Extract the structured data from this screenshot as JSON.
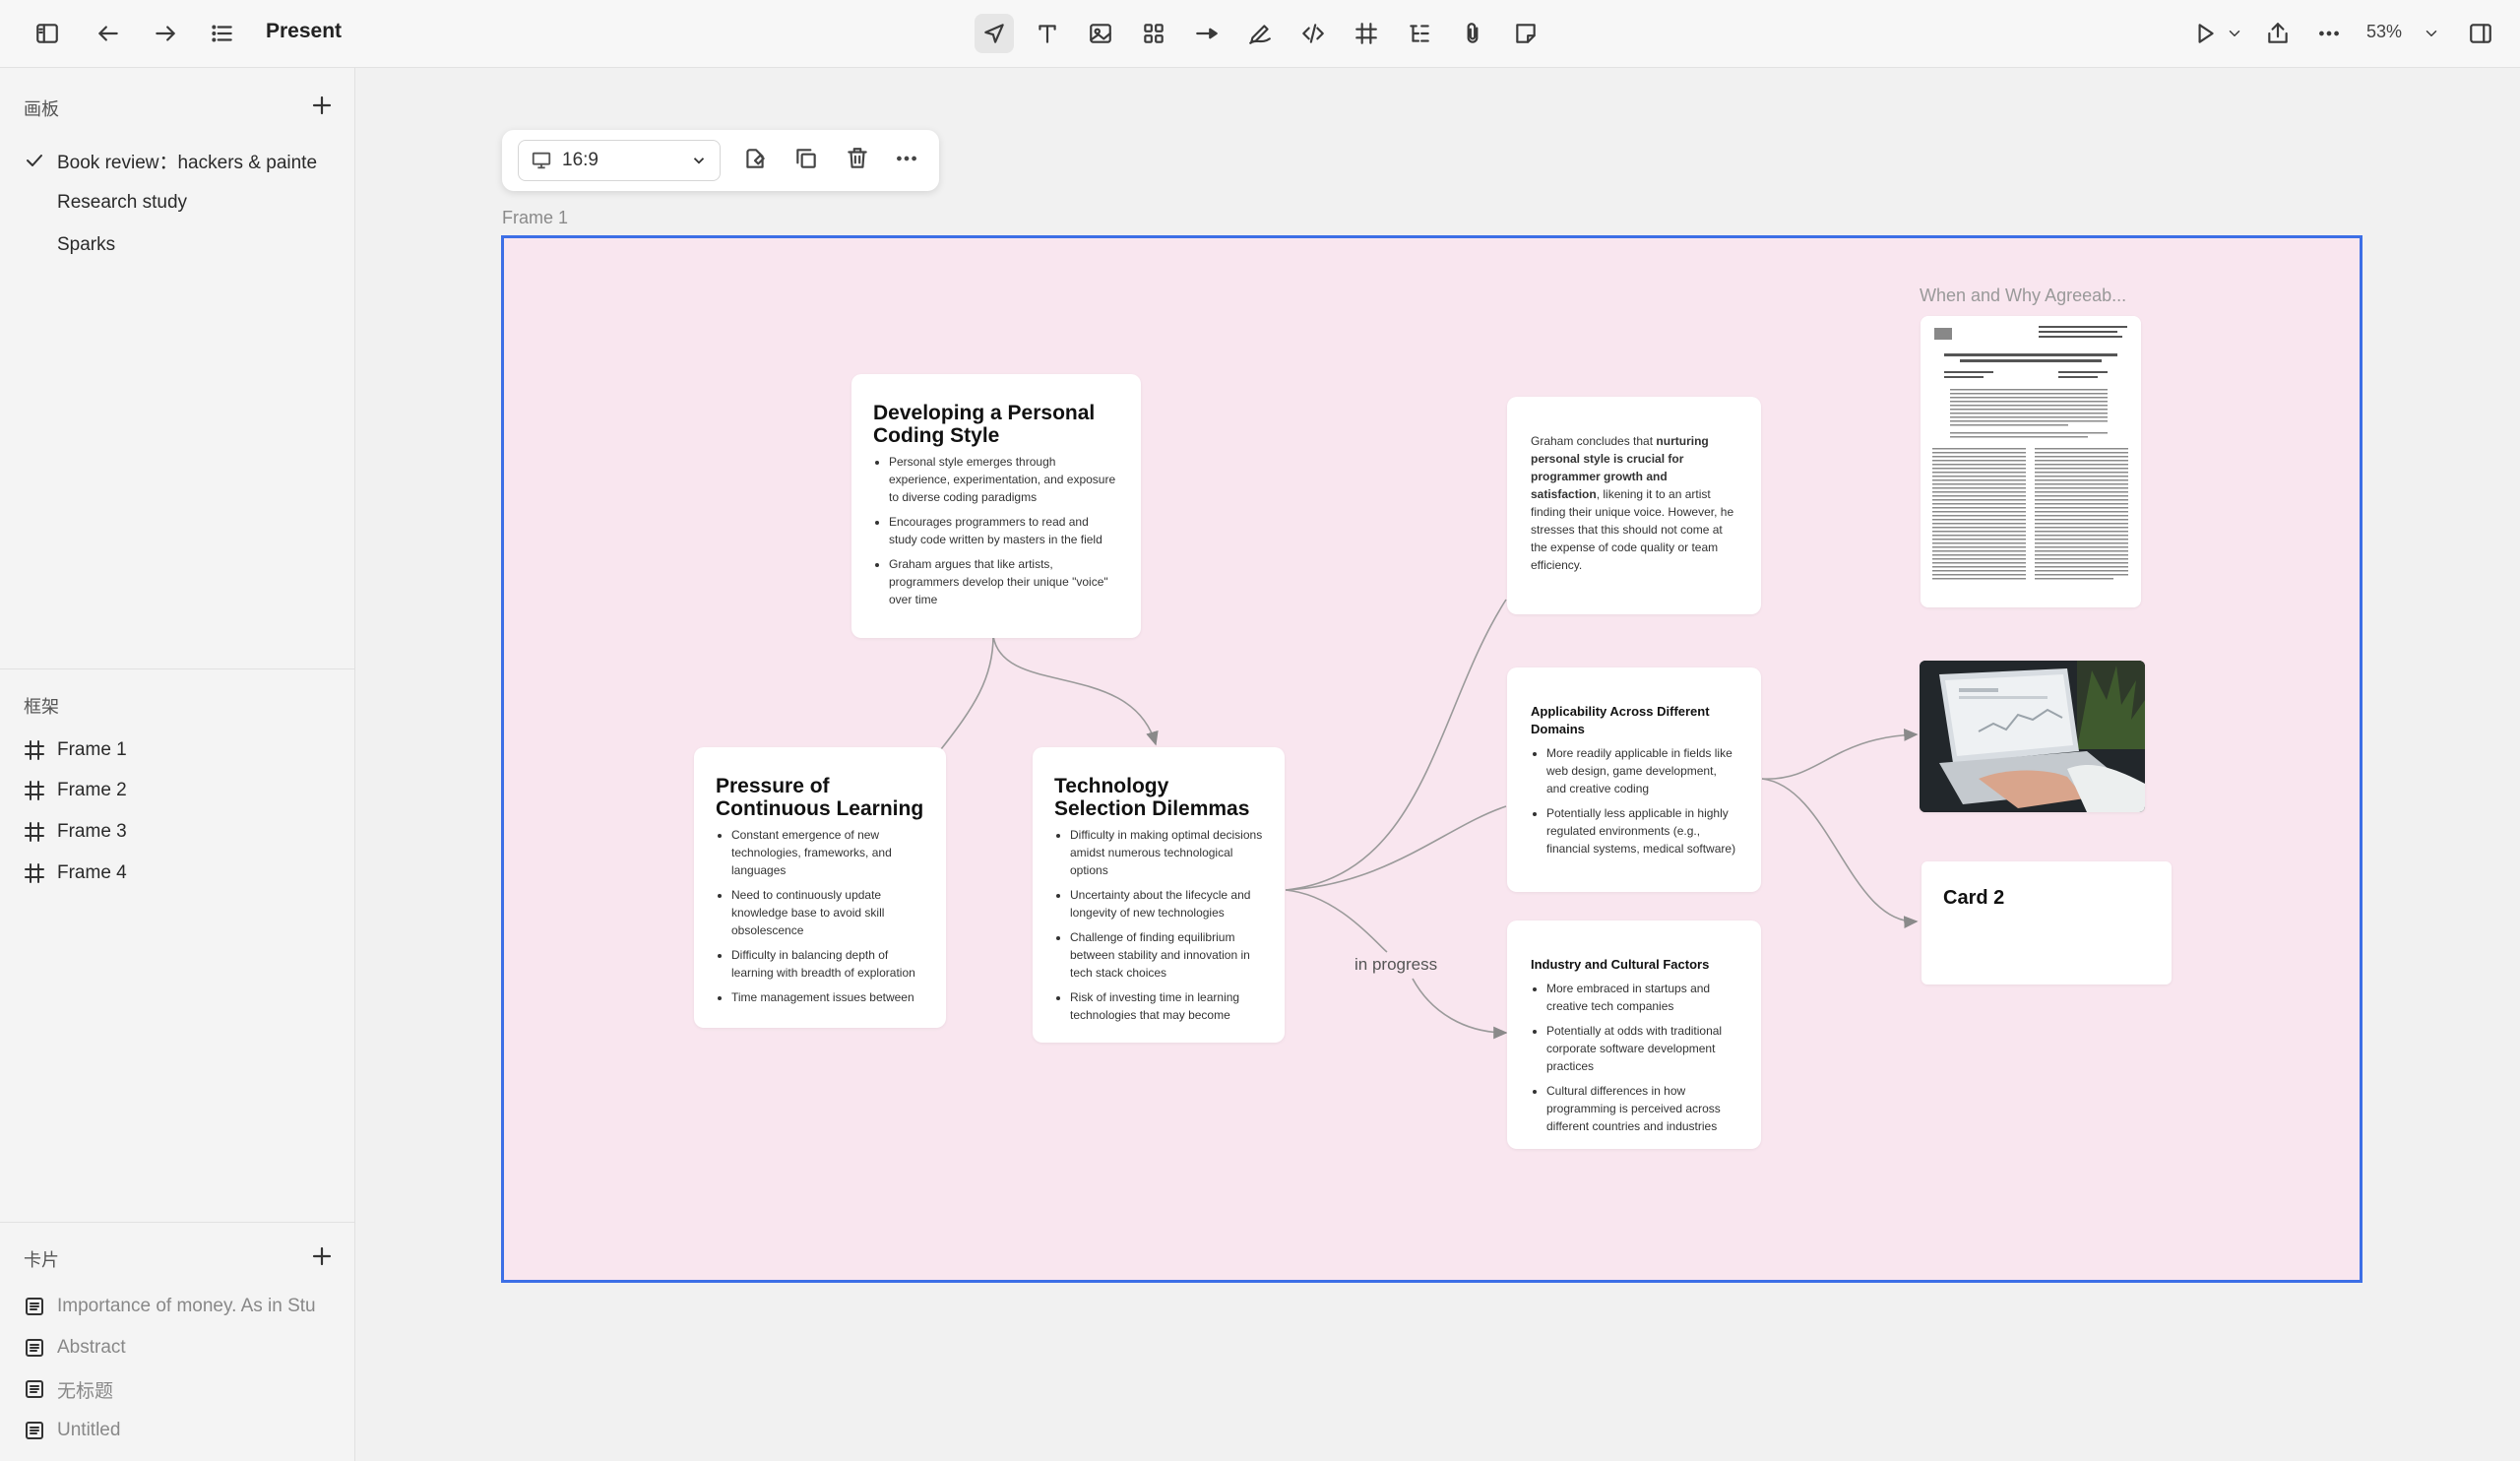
{
  "topbar": {
    "title": "Present",
    "zoom": "53%",
    "icons": [
      "sidebar-toggle-icon",
      "back-arrow-icon",
      "forward-arrow-icon",
      "outline-list-icon",
      "select-cursor-icon",
      "text-icon",
      "image-icon",
      "components-icon",
      "connector-arrow-icon",
      "pen-icon",
      "code-icon",
      "frame-icon",
      "mindmap-icon",
      "attachment-icon",
      "sticky-note-icon",
      "play-icon",
      "chevron-down-icon",
      "share-icon",
      "more-icon",
      "chevron-down-icon",
      "right-panel-icon"
    ]
  },
  "sidebar": {
    "boards_title": "画板",
    "boards": [
      {
        "label": "Book review：hackers & painte",
        "checked": true
      },
      {
        "label": "Research study",
        "checked": false
      },
      {
        "label": "Sparks",
        "checked": false
      }
    ],
    "frames_title": "框架",
    "frames": [
      "Frame 1",
      "Frame 2",
      "Frame 3",
      "Frame 4"
    ],
    "cards_title": "卡片",
    "cards": [
      "Importance of money. As in Stu",
      "Abstract",
      "无标题",
      "Untitled"
    ]
  },
  "frame_toolbar": {
    "ratio": "16:9"
  },
  "frame": {
    "label": "Frame 1",
    "background": "#f9e6ef",
    "border": "#3d6fe6"
  },
  "cards": {
    "coding_style": {
      "title": "Developing a Personal Coding Style",
      "bullets": [
        "Personal style emerges through experience, experimentation, and exposure to diverse coding paradigms",
        "Encourages programmers to read and study code written by masters in the field",
        "Graham argues that like artists, programmers develop their unique \"voice\" over time"
      ]
    },
    "pressure": {
      "title": "Pressure of Continuous Learning",
      "bullets": [
        "Constant emergence of new technologies, frameworks, and languages",
        "Need to continuously update knowledge base to avoid skill obsolescence",
        "Difficulty in balancing depth of learning with breadth of exploration",
        "Time management issues between"
      ]
    },
    "tech_selection": {
      "title": "Technology Selection Dilemmas",
      "bullets": [
        "Difficulty in making optimal decisions amidst numerous technological options",
        "Uncertainty about the lifecycle and longevity of new technologies",
        "Challenge of finding equilibrium between stability and innovation in tech stack choices",
        "Risk of investing time in learning technologies that may become"
      ]
    },
    "conclusion": {
      "p1": "Graham concludes that ",
      "bold": "nurturing personal style is crucial for programmer growth and satisfaction",
      "p2": ", likening it to an artist finding their unique voice. However, he stresses that this should not come at the expense of code quality or team efficiency."
    },
    "applicability": {
      "title": "Applicability Across Different Domains",
      "bullets": [
        "More readily applicable in fields like web design, game development, and creative coding",
        "Potentially less applicable in highly regulated environments (e.g., financial systems, medical software)"
      ]
    },
    "industry": {
      "title": "Industry and Cultural Factors",
      "bullets": [
        "More embraced in startups and creative tech companies",
        "Potentially at odds with traditional corporate software development practices",
        "Cultural differences in how programming is perceived across different countries and industries"
      ]
    },
    "card2": {
      "title": "Card 2"
    },
    "doc": {
      "title": "When and Why Agreeab..."
    }
  },
  "edge_label": "in progress"
}
